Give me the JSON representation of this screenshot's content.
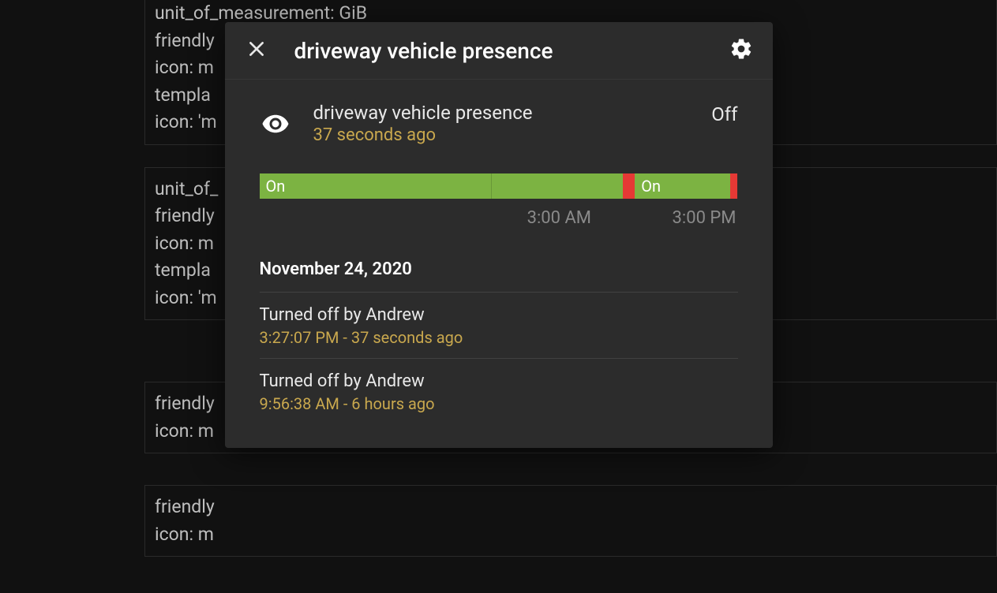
{
  "background": {
    "cards": [
      {
        "lines": [
          "unit_of_measurement: GiB",
          "friendly",
          "icon: m",
          "templa",
          "icon: 'm"
        ]
      },
      {
        "lines": [
          "unit_of_",
          "friendly",
          "icon: m",
          "templa",
          "icon: 'm"
        ]
      },
      {
        "lines": [
          "friendly",
          "icon: m"
        ]
      },
      {
        "lines": [
          "friendly",
          "icon: m"
        ]
      }
    ]
  },
  "dialog": {
    "title": "driveway vehicle presence",
    "entity": {
      "name": "driveway vehicle presence",
      "last_changed": "37 seconds ago",
      "state": "Off"
    },
    "timeline": {
      "segments": [
        {
          "state": "On",
          "label": "On",
          "width_pct": 48.5,
          "color": "green"
        },
        {
          "state": "On",
          "label": "",
          "width_pct": 27.5,
          "color": "green"
        },
        {
          "state": "Off",
          "label": "",
          "width_pct": 2.5,
          "color": "red"
        },
        {
          "state": "On",
          "label": "On",
          "width_pct": 20.0,
          "color": "green"
        },
        {
          "state": "Off",
          "label": "",
          "width_pct": 1.5,
          "color": "red"
        }
      ],
      "ticks": [
        "3:00 AM",
        "3:00 PM"
      ]
    },
    "history": {
      "date": "November 24, 2020",
      "items": [
        {
          "title": "Turned off by Andrew",
          "time": "3:27:07 PM - 37 seconds ago"
        },
        {
          "title": "Turned off by Andrew",
          "time": "9:56:38 AM - 6 hours ago"
        }
      ]
    }
  }
}
